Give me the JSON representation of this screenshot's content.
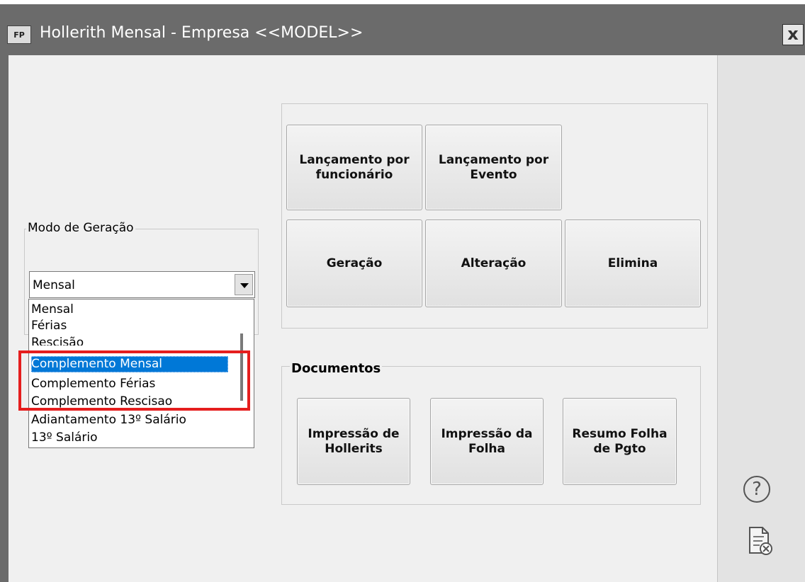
{
  "window": {
    "title": "Hollerith Mensal - Empresa <<MODEL>>",
    "app_icon": "FP",
    "close_label": "x"
  },
  "modo_geracao": {
    "label": "Modo de Geração",
    "selected": "Mensal",
    "options": [
      "Mensal",
      "Férias",
      "Rescisão",
      "Complemento Mensal",
      "Complemento Férias",
      "Complemento Rescisao",
      "Adiantamento 13º Salário",
      "13º Salário"
    ],
    "highlighted_option": "Complemento Mensal"
  },
  "actions": {
    "lanc_funcionario": "Lançamento por funcionário",
    "lanc_evento": "Lançamento por Evento",
    "geracao": "Geração",
    "alteracao": "Alteração",
    "elimina": "Elimina"
  },
  "documentos": {
    "label": "Documentos",
    "impressao_hollerits": "Impressão de Hollerits",
    "impressao_folha": "Impressão da Folha",
    "resumo_folha": "Resumo Folha de Pgto"
  },
  "side": {
    "help_icon": "help-icon",
    "help_glyph": "?",
    "doc_icon": "document-close-icon"
  },
  "colors": {
    "selection": "#0078d7",
    "annotation_box": "#e51e1e",
    "titlebar": "#6b6b6b"
  }
}
